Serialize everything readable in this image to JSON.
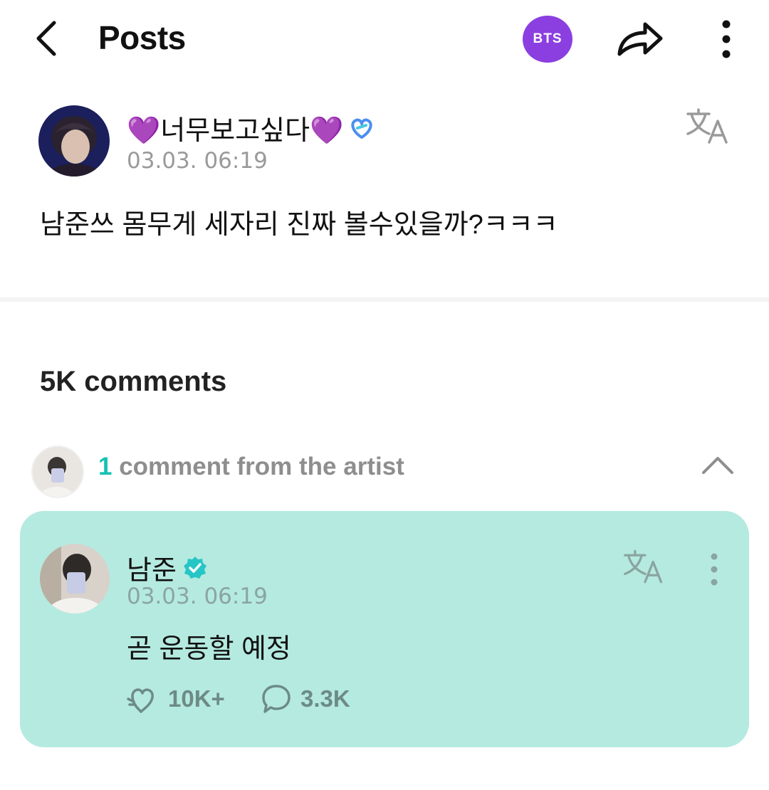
{
  "header": {
    "title": "Posts",
    "community_badge": "BTS",
    "badge_color": "#8b3fe0"
  },
  "post": {
    "author": "💜너무보고싶다💜",
    "timestamp": "03.03. 06:19",
    "body": "남준쓰 몸무게 세자리 진짜 볼수있을까?ㅋㅋㅋ",
    "icons": [
      "back-icon",
      "share-icon",
      "more-icon",
      "translate-icon",
      "fan-badge-icon"
    ]
  },
  "comments": {
    "count_label": "5K comments",
    "artist_summary": {
      "count": "1",
      "label": " comment from the artist"
    },
    "artist_comment": {
      "author": "남준",
      "timestamp": "03.03. 06:19",
      "body": "곧 운동할 예정",
      "likes": "10K+",
      "replies": "3.3K",
      "card_color": "#b5eae0",
      "verified_color": "#27c6c6"
    }
  }
}
